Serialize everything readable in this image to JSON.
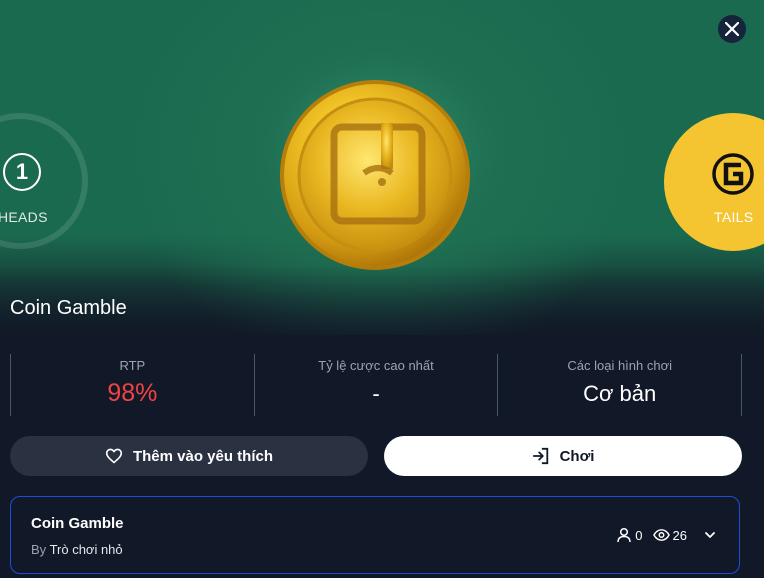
{
  "hero": {
    "game_title": "Coin Gamble",
    "heads": {
      "count": "1",
      "label": "HEADS"
    },
    "tails": {
      "label": "TAILS"
    },
    "colors": {
      "background": "#1a6a50",
      "tails": "#f5c531",
      "coin": "#e8b81f"
    }
  },
  "stats": [
    {
      "label": "RTP",
      "value": "98%",
      "color": "#ef4444"
    },
    {
      "label": "Tỷ lệ cược cao nhất",
      "value": "-"
    },
    {
      "label": "Các loại hình chơi",
      "value": "Cơ bản"
    }
  ],
  "actions": {
    "favorite_label": "Thêm vào yêu thích",
    "play_label": "Chơi"
  },
  "info": {
    "title": "Coin Gamble",
    "by_prefix": "By",
    "author": "Trò chơi nhỏ",
    "players": "0",
    "views": "26"
  }
}
